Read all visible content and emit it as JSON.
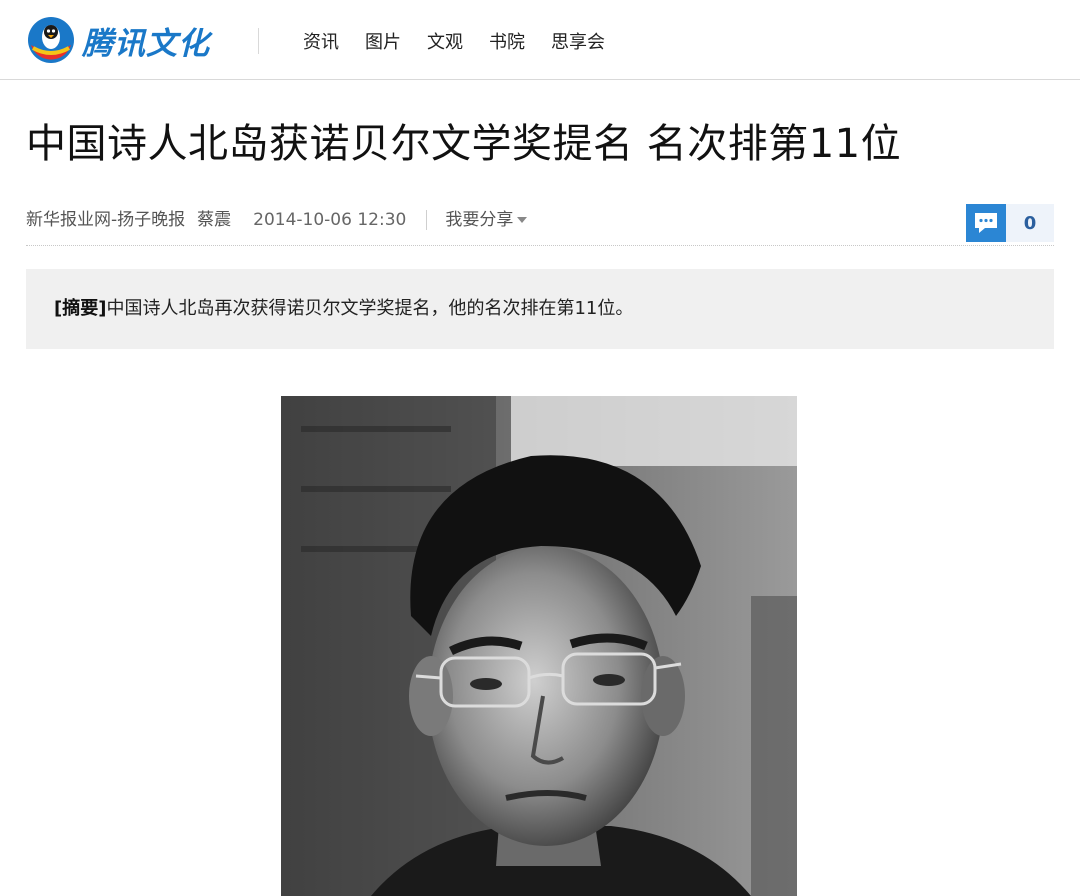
{
  "header": {
    "logo_text": "腾讯文化",
    "nav": [
      "资讯",
      "图片",
      "文观",
      "书院",
      "思享会"
    ]
  },
  "article": {
    "title": "中国诗人北岛获诺贝尔文学奖提名 名次排第11位",
    "meta": {
      "source": "新华报业网-扬子晚报",
      "author": "蔡震",
      "time": "2014-10-06 12:30",
      "share_label": "我要分享"
    },
    "comment_count": "0",
    "summary": {
      "label": "[摘要]",
      "text": "中国诗人北岛再次获得诺贝尔文学奖提名，他的名次排在第11位。"
    }
  },
  "icons": {
    "logo": "tencent-penguin-icon",
    "comment": "comment-bubble-icon",
    "share_caret": "caret-down-icon"
  },
  "colors": {
    "brand_blue": "#1a78c8",
    "comment_blue": "#2b86d4",
    "summary_bg": "#f0f0f0"
  }
}
